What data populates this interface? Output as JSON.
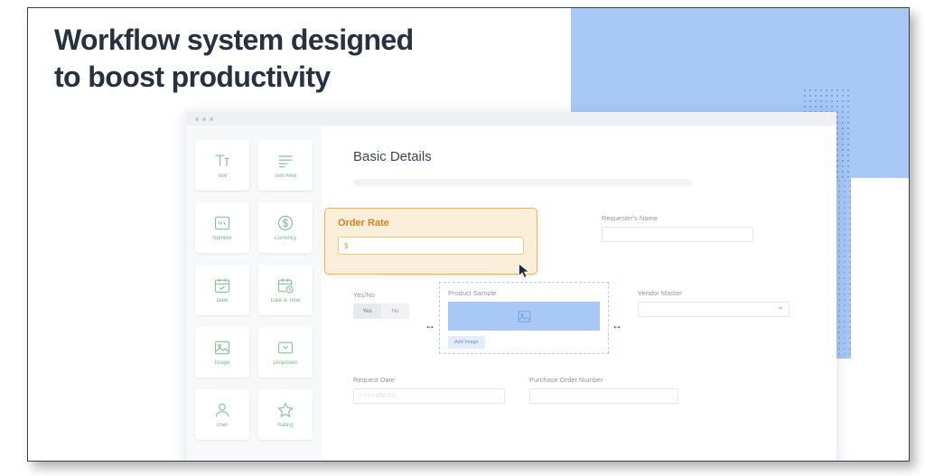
{
  "headline": {
    "line1": "Workflow system designed",
    "line2": "to boost productivity"
  },
  "window": {
    "dots": [
      "dot-1",
      "dot-2",
      "dot-3"
    ]
  },
  "palette": {
    "items": [
      {
        "label": "Text",
        "icon": "text-icon"
      },
      {
        "label": "Text Area",
        "icon": "text-area-icon"
      },
      {
        "label": "Number",
        "icon": "number-icon"
      },
      {
        "label": "Currency",
        "icon": "currency-icon"
      },
      {
        "label": "Date",
        "icon": "date-icon"
      },
      {
        "label": "Date & Time",
        "icon": "date-time-icon"
      },
      {
        "label": "Image",
        "icon": "image-icon"
      },
      {
        "label": "Dropdown",
        "icon": "dropdown-icon"
      },
      {
        "label": "User",
        "icon": "user-icon"
      },
      {
        "label": "Rating",
        "icon": "rating-icon"
      }
    ]
  },
  "form": {
    "title": "Basic Details",
    "requester": {
      "label": "Requester's Name",
      "value": "",
      "placeholder": ""
    },
    "yesno": {
      "label": "Yes/No",
      "options": [
        "Yes",
        "No"
      ],
      "selected": "Yes"
    },
    "product_sample": {
      "label": "Product Sample",
      "add_button": "Add Image",
      "image_icon": "image-placeholder-icon"
    },
    "vendor": {
      "label": "Vendor Master",
      "value": "",
      "placeholder": ""
    },
    "request_date": {
      "label": "Request Date",
      "value": "",
      "placeholder": "YYYY-MM-DD"
    },
    "purchase_order": {
      "label": "Purchase Order Number",
      "value": "",
      "placeholder": ""
    }
  },
  "popup": {
    "title": "Order Rate",
    "input_value": "$",
    "input_placeholder": "$"
  },
  "colors": {
    "accent_blue": "#a8c8f5",
    "palette_green": "#5aa96f",
    "popup_border": "#e8b457",
    "popup_bg": "#fcefd9",
    "popup_title": "#d4821f",
    "heading_dark": "#28313f"
  }
}
